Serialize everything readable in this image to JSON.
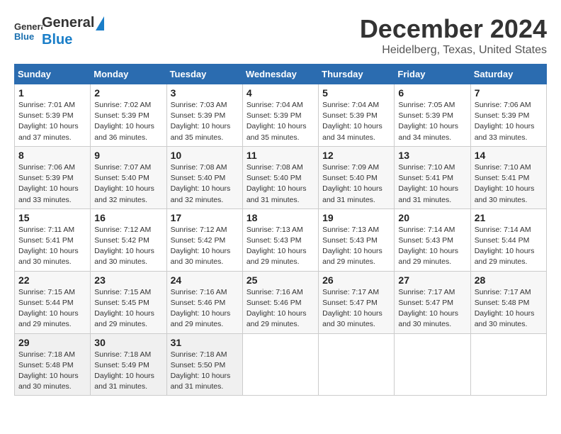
{
  "header": {
    "logo_line1": "General",
    "logo_line2": "Blue",
    "title": "December 2024",
    "subtitle": "Heidelberg, Texas, United States"
  },
  "weekdays": [
    "Sunday",
    "Monday",
    "Tuesday",
    "Wednesday",
    "Thursday",
    "Friday",
    "Saturday"
  ],
  "weeks": [
    [
      {
        "day": "1",
        "sunrise": "7:01 AM",
        "sunset": "5:39 PM",
        "daylight": "10 hours and 37 minutes."
      },
      {
        "day": "2",
        "sunrise": "7:02 AM",
        "sunset": "5:39 PM",
        "daylight": "10 hours and 36 minutes."
      },
      {
        "day": "3",
        "sunrise": "7:03 AM",
        "sunset": "5:39 PM",
        "daylight": "10 hours and 35 minutes."
      },
      {
        "day": "4",
        "sunrise": "7:04 AM",
        "sunset": "5:39 PM",
        "daylight": "10 hours and 35 minutes."
      },
      {
        "day": "5",
        "sunrise": "7:04 AM",
        "sunset": "5:39 PM",
        "daylight": "10 hours and 34 minutes."
      },
      {
        "day": "6",
        "sunrise": "7:05 AM",
        "sunset": "5:39 PM",
        "daylight": "10 hours and 34 minutes."
      },
      {
        "day": "7",
        "sunrise": "7:06 AM",
        "sunset": "5:39 PM",
        "daylight": "10 hours and 33 minutes."
      }
    ],
    [
      {
        "day": "8",
        "sunrise": "7:06 AM",
        "sunset": "5:39 PM",
        "daylight": "10 hours and 33 minutes."
      },
      {
        "day": "9",
        "sunrise": "7:07 AM",
        "sunset": "5:40 PM",
        "daylight": "10 hours and 32 minutes."
      },
      {
        "day": "10",
        "sunrise": "7:08 AM",
        "sunset": "5:40 PM",
        "daylight": "10 hours and 32 minutes."
      },
      {
        "day": "11",
        "sunrise": "7:08 AM",
        "sunset": "5:40 PM",
        "daylight": "10 hours and 31 minutes."
      },
      {
        "day": "12",
        "sunrise": "7:09 AM",
        "sunset": "5:40 PM",
        "daylight": "10 hours and 31 minutes."
      },
      {
        "day": "13",
        "sunrise": "7:10 AM",
        "sunset": "5:41 PM",
        "daylight": "10 hours and 31 minutes."
      },
      {
        "day": "14",
        "sunrise": "7:10 AM",
        "sunset": "5:41 PM",
        "daylight": "10 hours and 30 minutes."
      }
    ],
    [
      {
        "day": "15",
        "sunrise": "7:11 AM",
        "sunset": "5:41 PM",
        "daylight": "10 hours and 30 minutes."
      },
      {
        "day": "16",
        "sunrise": "7:12 AM",
        "sunset": "5:42 PM",
        "daylight": "10 hours and 30 minutes."
      },
      {
        "day": "17",
        "sunrise": "7:12 AM",
        "sunset": "5:42 PM",
        "daylight": "10 hours and 30 minutes."
      },
      {
        "day": "18",
        "sunrise": "7:13 AM",
        "sunset": "5:43 PM",
        "daylight": "10 hours and 29 minutes."
      },
      {
        "day": "19",
        "sunrise": "7:13 AM",
        "sunset": "5:43 PM",
        "daylight": "10 hours and 29 minutes."
      },
      {
        "day": "20",
        "sunrise": "7:14 AM",
        "sunset": "5:43 PM",
        "daylight": "10 hours and 29 minutes."
      },
      {
        "day": "21",
        "sunrise": "7:14 AM",
        "sunset": "5:44 PM",
        "daylight": "10 hours and 29 minutes."
      }
    ],
    [
      {
        "day": "22",
        "sunrise": "7:15 AM",
        "sunset": "5:44 PM",
        "daylight": "10 hours and 29 minutes."
      },
      {
        "day": "23",
        "sunrise": "7:15 AM",
        "sunset": "5:45 PM",
        "daylight": "10 hours and 29 minutes."
      },
      {
        "day": "24",
        "sunrise": "7:16 AM",
        "sunset": "5:46 PM",
        "daylight": "10 hours and 29 minutes."
      },
      {
        "day": "25",
        "sunrise": "7:16 AM",
        "sunset": "5:46 PM",
        "daylight": "10 hours and 29 minutes."
      },
      {
        "day": "26",
        "sunrise": "7:17 AM",
        "sunset": "5:47 PM",
        "daylight": "10 hours and 30 minutes."
      },
      {
        "day": "27",
        "sunrise": "7:17 AM",
        "sunset": "5:47 PM",
        "daylight": "10 hours and 30 minutes."
      },
      {
        "day": "28",
        "sunrise": "7:17 AM",
        "sunset": "5:48 PM",
        "daylight": "10 hours and 30 minutes."
      }
    ],
    [
      {
        "day": "29",
        "sunrise": "7:18 AM",
        "sunset": "5:48 PM",
        "daylight": "10 hours and 30 minutes."
      },
      {
        "day": "30",
        "sunrise": "7:18 AM",
        "sunset": "5:49 PM",
        "daylight": "10 hours and 31 minutes."
      },
      {
        "day": "31",
        "sunrise": "7:18 AM",
        "sunset": "5:50 PM",
        "daylight": "10 hours and 31 minutes."
      },
      null,
      null,
      null,
      null
    ]
  ]
}
